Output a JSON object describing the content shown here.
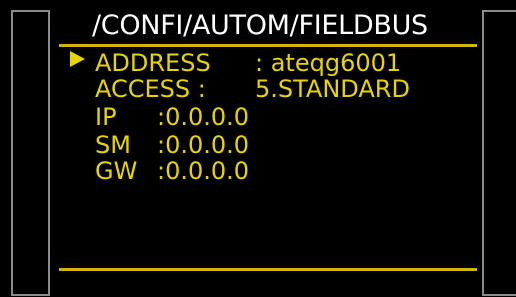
{
  "screen": {
    "path_title": "/CONFI/AUTOM/FIELDBUS"
  },
  "menu": {
    "cursor_icon": "right-triangle-icon",
    "items": [
      {
        "label": "ADDRESS",
        "value": ": ateqg6001"
      },
      {
        "label": "ACCESS :",
        "value": "5.STANDARD"
      },
      {
        "label": "IP",
        "value": ":0.0.0.0"
      },
      {
        "label": "SM",
        "value": ":0.0.0.0"
      },
      {
        "label": "GW",
        "value": ":0.0.0.0"
      }
    ]
  },
  "colors": {
    "text_active": "#e7d400",
    "title": "#ffffff",
    "rule": "#d1b500",
    "background": "#000000"
  }
}
